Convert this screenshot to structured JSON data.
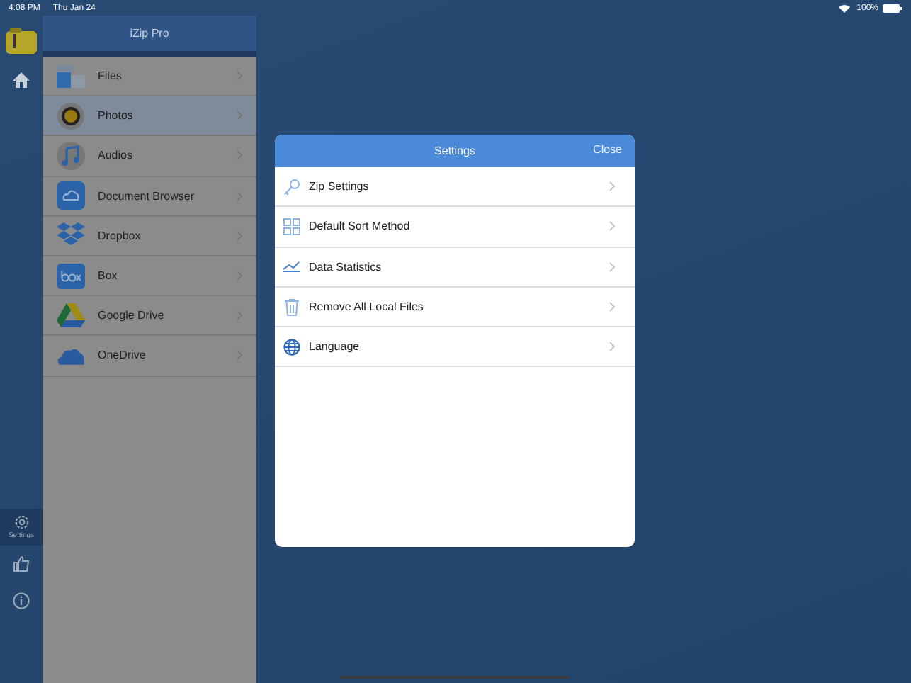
{
  "status_bar": {
    "time": "4:08 PM",
    "date": "Thu Jan 24",
    "battery": "100%"
  },
  "rail": {
    "items": [
      {
        "kind": "home",
        "selected": false
      },
      {
        "kind": "settings",
        "label": "Settings",
        "selected": true
      },
      {
        "kind": "like",
        "selected": false
      },
      {
        "kind": "info",
        "selected": false
      }
    ]
  },
  "sidebar": {
    "title": "iZip Pro",
    "items": [
      {
        "kind": "files",
        "label": "Files",
        "selected": false
      },
      {
        "kind": "photos",
        "label": "Photos",
        "selected": true
      },
      {
        "kind": "audios",
        "label": "Audios",
        "selected": false
      },
      {
        "kind": "cloud",
        "label": "Document Browser",
        "selected": false
      },
      {
        "kind": "dropbox",
        "label": "Dropbox",
        "selected": false
      },
      {
        "kind": "box",
        "label": "Box",
        "selected": false
      },
      {
        "kind": "drive",
        "label": "Google Drive",
        "selected": false
      },
      {
        "kind": "onedrive",
        "label": "OneDrive",
        "selected": false
      }
    ]
  },
  "settings_dialog": {
    "title": "Settings",
    "close": "Close",
    "items": [
      {
        "kind": "key",
        "label": "Zip Settings"
      },
      {
        "kind": "grid",
        "label": "Default Sort Method"
      },
      {
        "kind": "chart",
        "label": "Data Statistics"
      },
      {
        "kind": "trash",
        "label": "Remove All Local Files"
      },
      {
        "kind": "globe",
        "label": "Language"
      }
    ]
  }
}
